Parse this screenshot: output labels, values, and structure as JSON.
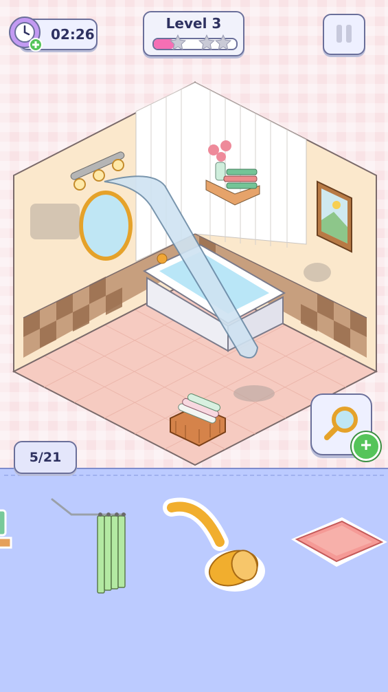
{
  "hud": {
    "timer": "02:26",
    "level_label": "Level 3",
    "level_progress": 0.25,
    "stars_total": 3,
    "stars_earned": 0
  },
  "counter": {
    "text": "5/21",
    "found": 5,
    "total": 21
  },
  "tray": {
    "items": [
      {
        "name": "green-item-partial",
        "icon": "green-box"
      },
      {
        "name": "shower-curtain",
        "icon": "shower-curtain"
      },
      {
        "name": "shower-head",
        "icon": "shower-head"
      },
      {
        "name": "bath-mat",
        "icon": "bath-mat"
      }
    ]
  },
  "colors": {
    "accent_pink": "#f56fb4",
    "tray_blue": "#bccbff",
    "outline": "#6a6f9a",
    "plus_green": "#55c45a"
  }
}
